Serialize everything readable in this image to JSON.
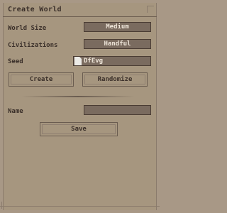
{
  "window": {
    "title": "Create World"
  },
  "settings": {
    "world_size": {
      "label": "World Size",
      "value": "Medium"
    },
    "civilizations": {
      "label": "Civilizations",
      "value": "Handful"
    },
    "seed": {
      "label": "Seed",
      "value": "DfEvg",
      "icon": "document-icon"
    }
  },
  "actions": {
    "create_label": "Create",
    "randomize_label": "Randomize"
  },
  "name": {
    "label": "Name",
    "value": ""
  },
  "footer": {
    "save_label": "Save"
  },
  "colors": {
    "background": "#a89886",
    "field_bg": "#7a6b5f",
    "text_dark": "#3b302a",
    "text_light": "#efe6da"
  }
}
